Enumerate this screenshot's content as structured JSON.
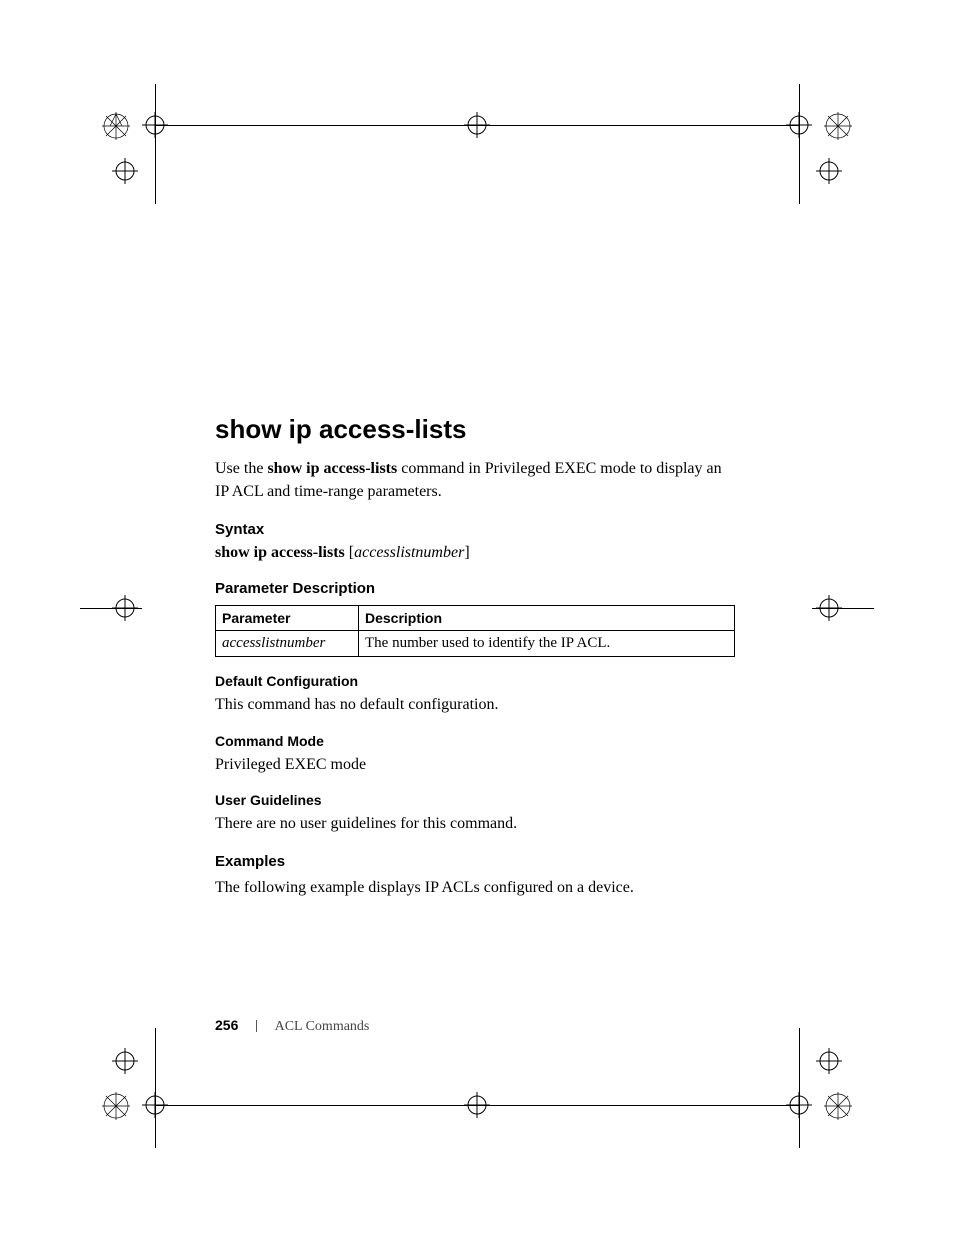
{
  "title": "show ip access-lists",
  "intro_prefix": "Use the ",
  "intro_bold": "show ip access-lists",
  "intro_suffix": " command in Privileged EXEC mode to display an IP ACL and time-range parameters.",
  "syntax": {
    "heading": "Syntax",
    "cmd_bold": "show ip access-lists ",
    "bracket_open": "[",
    "arg_italic": "accesslistnumber",
    "bracket_close": "]"
  },
  "param_desc": {
    "heading": "Parameter Description",
    "headers": {
      "p": "Parameter",
      "d": "Description"
    },
    "rows": [
      {
        "p": "accesslistnumber",
        "d": "The number used to identify the IP ACL."
      }
    ]
  },
  "default_cfg": {
    "heading": "Default Configuration",
    "text": "This command has no default configuration."
  },
  "cmd_mode": {
    "heading": "Command Mode",
    "text": "Privileged EXEC mode"
  },
  "user_guidelines": {
    "heading": "User Guidelines",
    "text": "There are no user guidelines for this command."
  },
  "examples": {
    "heading": "Examples",
    "text": "The following example displays IP ACLs configured on a device."
  },
  "footer": {
    "page": "256",
    "section": "ACL Commands"
  }
}
